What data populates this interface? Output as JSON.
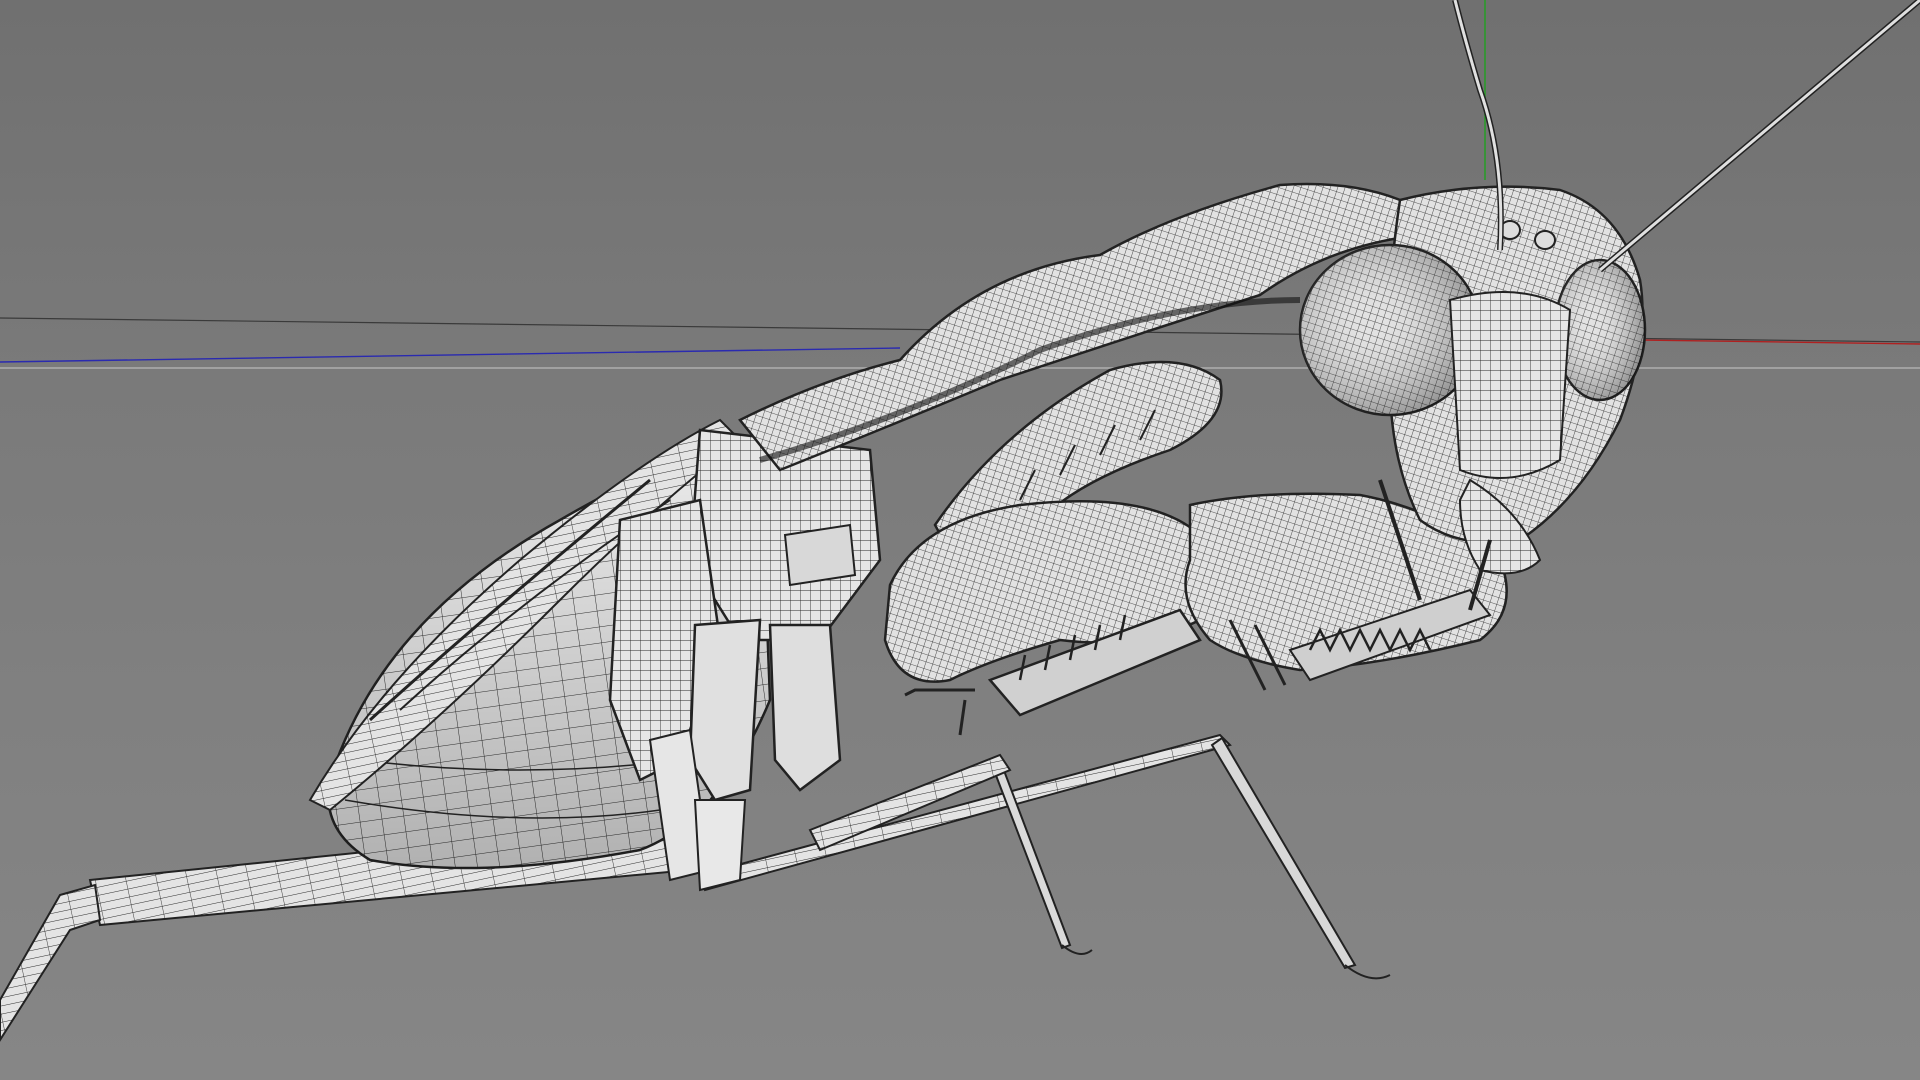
{
  "viewport": {
    "background": "#7c7c7c",
    "axis_colors": {
      "x_axis": "#b02020",
      "y_axis": "#20a020",
      "z_axis": "#2020b0",
      "grid_line": "#c8c8c8"
    },
    "model": {
      "subject": "praying-mantis",
      "display_mode": "wireframe-on-shaded",
      "surface_color": "#e8e8e8",
      "wire_color": "#222222"
    }
  }
}
